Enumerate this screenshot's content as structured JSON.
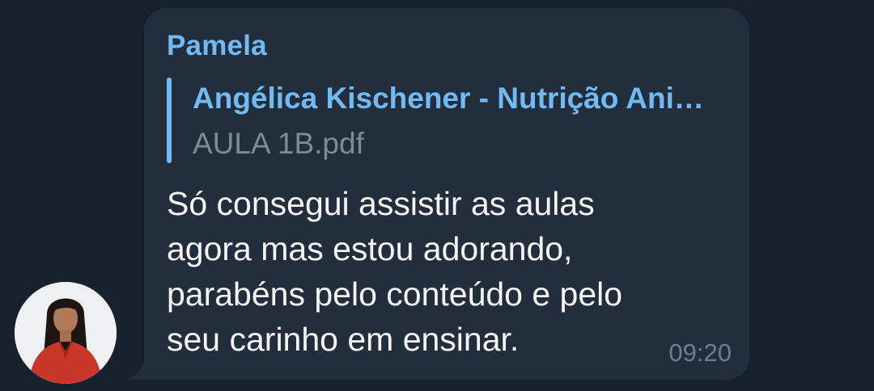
{
  "message": {
    "sender_name": "Pamela",
    "reply": {
      "title": "Angélica Kischener - Nutrição Ani…",
      "subtitle": "AULA 1B.pdf"
    },
    "text_lines": [
      "Só consegui assistir as aulas",
      "agora mas estou adorando,",
      "parabéns pelo conteúdo e pelo",
      "seu carinho em ensinar."
    ],
    "time": "09:20"
  },
  "avatar": {
    "icon": "user-avatar-photo"
  },
  "colors": {
    "background": "#17212b",
    "bubble": "#232e3c",
    "accent": "#71baf4",
    "text": "#f5f5f5",
    "muted": "#7d8b99"
  }
}
